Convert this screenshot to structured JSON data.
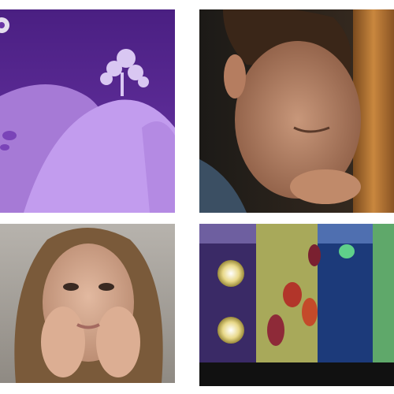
{
  "tiles": [
    {
      "icon": "purple-hills-tree-illustration"
    },
    {
      "icon": "man-resting-head-on-hand-photo"
    },
    {
      "icon": "woman-hands-on-cheeks-photo"
    },
    {
      "icon": "abstract-room-with-glowing-orbs-art"
    }
  ],
  "colors": {
    "background": "#ffffff",
    "illustration_sky": "#5b2a93",
    "illustration_hills": "#b28ae0",
    "portrait_warm": "#6b4a2a",
    "portrait_cool": "#9a8f86",
    "art_blue": "#1c3a7a",
    "art_olive": "#a8a95a",
    "art_green": "#5fa86a"
  }
}
